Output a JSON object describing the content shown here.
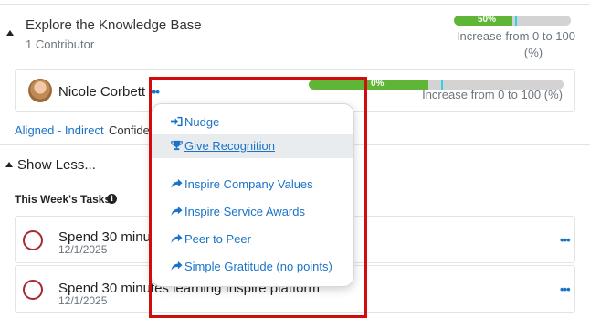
{
  "goal": {
    "title": "Explore the Knowledge Base",
    "subtitle": "1 Contributor",
    "progress": {
      "percent_label": "50%",
      "fraction": 0.5,
      "target_fraction": 0.52
    },
    "increase_text_line1": "Increase from 0 to 100",
    "increase_text_line2": "(%)"
  },
  "contributor": {
    "name": "Nicole Corbett",
    "menu_icon": "ellipsis-icon",
    "progress": {
      "percent_label": "0%",
      "fraction": 0.47,
      "target_fraction": 0.52
    },
    "increase_text": "Increase from 0 to 100 (%)"
  },
  "alignment": {
    "aligned_label": "Aligned - Indirect",
    "confidence_label": "Confide"
  },
  "toggle": {
    "show_less_label": "Show Less..."
  },
  "tasks_section": {
    "heading": "This Week's Tasks",
    "info_icon": "info-icon",
    "tasks": [
      {
        "title": "Spend 30 minu",
        "date": "12/1/2025"
      },
      {
        "title": "Spend 30 minutes learning Inspire platform",
        "date": "12/1/2025"
      }
    ]
  },
  "menu": {
    "items": [
      {
        "label": "Nudge",
        "icon": "sign-in-icon",
        "active": false
      },
      {
        "label": "Give Recognition",
        "icon": "trophy-icon",
        "active": true
      },
      {
        "label": "Inspire Company Values",
        "icon": "share-arrow-icon",
        "active": false
      },
      {
        "label": "Inspire Service Awards",
        "icon": "share-arrow-icon",
        "active": false
      },
      {
        "label": "Peer to Peer",
        "icon": "share-arrow-icon",
        "active": false
      },
      {
        "label": "Simple Gratitude (no points)",
        "icon": "share-arrow-icon",
        "active": false
      }
    ]
  },
  "colors": {
    "accent": "#1a73c8",
    "progress_fill": "#5fb536",
    "progress_track": "#d3d3d3",
    "progress_marker": "#2dd4e6",
    "task_circle": "#a52834",
    "highlight_box": "#d10c0c"
  }
}
